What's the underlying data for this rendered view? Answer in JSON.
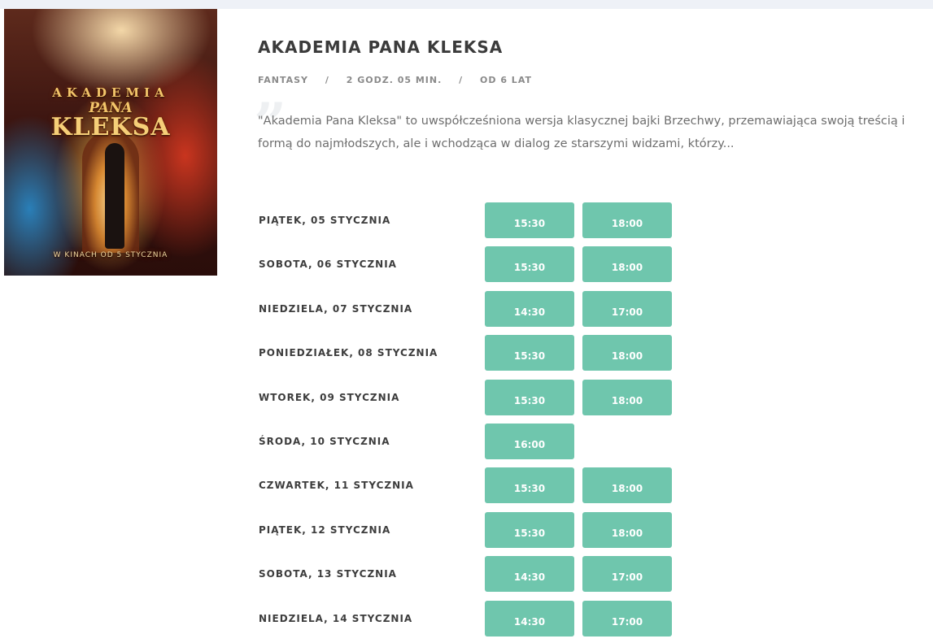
{
  "movie": {
    "title": "AKADEMIA PANA KLEKSA",
    "genre": "FANTASY",
    "duration": "2 GODZ. 05 MIN.",
    "age": "OD 6 LAT",
    "separator": "/",
    "description": "\"Akademia Pana Kleksa\" to uwspółcześniona wersja klasycznej bajki Brzechwy, przemawiająca swoją treścią i formą do najmłodszych, ale i wchodząca w dialog ze starszymi widzami, którzy...",
    "poster": {
      "line1": "AKADEMIA",
      "line2": "PANA",
      "line3": "KLEKSA",
      "tagline": "W KINACH OD 5 STYCZNIA"
    }
  },
  "colors": {
    "accent": "#6fc6ad",
    "title": "#3b3b3b",
    "meta": "#8a8a8a",
    "text": "#6e6e6e"
  },
  "schedule": [
    {
      "day": "PIĄTEK, 05 STYCZNIA",
      "times": [
        "15:30",
        "18:00"
      ]
    },
    {
      "day": "SOBOTA, 06 STYCZNIA",
      "times": [
        "15:30",
        "18:00"
      ]
    },
    {
      "day": "NIEDZIELA, 07 STYCZNIA",
      "times": [
        "14:30",
        "17:00"
      ]
    },
    {
      "day": "PONIEDZIAŁEK, 08 STYCZNIA",
      "times": [
        "15:30",
        "18:00"
      ]
    },
    {
      "day": "WTOREK, 09 STYCZNIA",
      "times": [
        "15:30",
        "18:00"
      ]
    },
    {
      "day": "ŚRODA, 10 STYCZNIA",
      "times": [
        "16:00"
      ]
    },
    {
      "day": "CZWARTEK, 11 STYCZNIA",
      "times": [
        "15:30",
        "18:00"
      ]
    },
    {
      "day": "PIĄTEK, 12 STYCZNIA",
      "times": [
        "15:30",
        "18:00"
      ]
    },
    {
      "day": "SOBOTA, 13 STYCZNIA",
      "times": [
        "14:30",
        "17:00"
      ]
    },
    {
      "day": "NIEDZIELA, 14 STYCZNIA",
      "times": [
        "14:30",
        "17:00"
      ]
    }
  ]
}
